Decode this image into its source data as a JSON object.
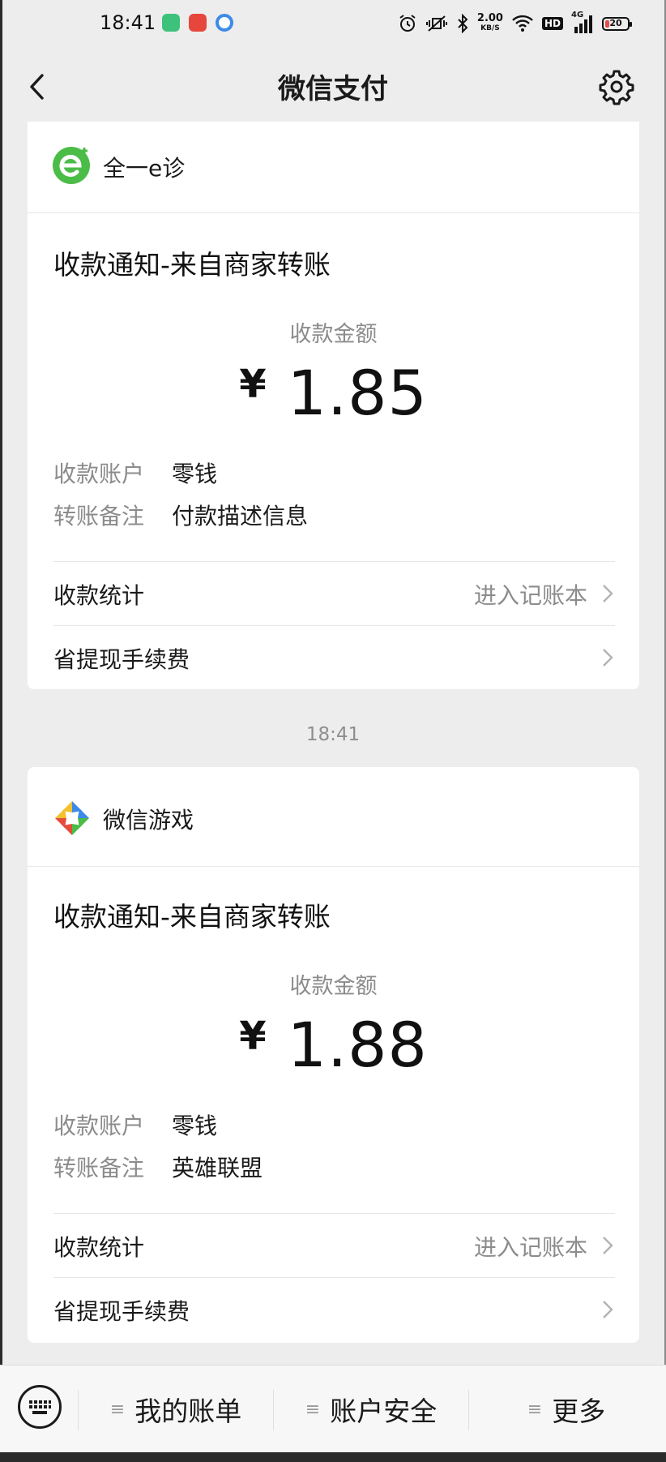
{
  "status_bar": {
    "time": "18:41",
    "net_speed": "2.00",
    "net_unit": "KB/S",
    "hd_label": "HD",
    "signal_label": "4G",
    "battery": "20",
    "battery_level": 0.2
  },
  "nav": {
    "title": "微信支付"
  },
  "cards": [
    {
      "brand": "全一e诊",
      "notice_title": "收款通知-来自商家转账",
      "amount_label": "收款金额",
      "currency": "¥",
      "amount": "1.85",
      "account_key": "收款账户",
      "account_value": "零钱",
      "remark_key": "转账备注",
      "remark_value": "付款描述信息",
      "stats_label": "收款统计",
      "stats_link": "进入记账本",
      "fee_label": "省提现手续费"
    },
    {
      "brand": "微信游戏",
      "notice_title": "收款通知-来自商家转账",
      "amount_label": "收款金额",
      "currency": "¥",
      "amount": "1.88",
      "account_key": "收款账户",
      "account_value": "零钱",
      "remark_key": "转账备注",
      "remark_value": "英雄联盟",
      "stats_label": "收款统计",
      "stats_link": "进入记账本",
      "fee_label": "省提现手续费"
    }
  ],
  "time_separator": "18:41",
  "bottom_menu": {
    "items": [
      {
        "label": "我的账单"
      },
      {
        "label": "账户安全"
      },
      {
        "label": "更多"
      }
    ]
  },
  "colors": {
    "accent_green": "#4cbc48",
    "background": "#ededed"
  }
}
